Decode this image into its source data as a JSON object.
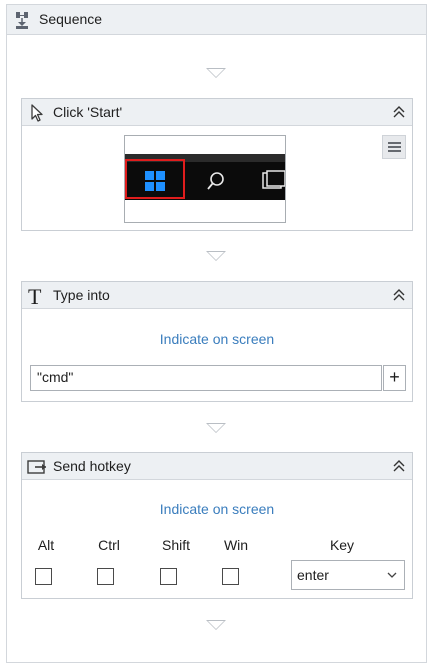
{
  "sequence": {
    "title": "Sequence",
    "icon": "sequence-icon"
  },
  "activities": {
    "click": {
      "title": "Click 'Start'",
      "icon": "cursor-icon",
      "screenshot_icon": "windows-start-icon"
    },
    "type_into": {
      "title": "Type into",
      "icon": "text-t-icon",
      "indicate": "Indicate on screen",
      "value": "\"cmd\"",
      "plus": "+"
    },
    "send_hotkey": {
      "title": "Send hotkey",
      "icon": "hotkey-icon",
      "indicate": "Indicate on screen",
      "modifiers": [
        "Alt",
        "Ctrl",
        "Shift",
        "Win"
      ],
      "key_label": "Key",
      "key_value": "enter"
    }
  },
  "colors": {
    "link": "#3a7dbd",
    "header_bg": "#edf0f3",
    "highlight": "#e01d1d",
    "windows_blue": "#1e90ff"
  }
}
